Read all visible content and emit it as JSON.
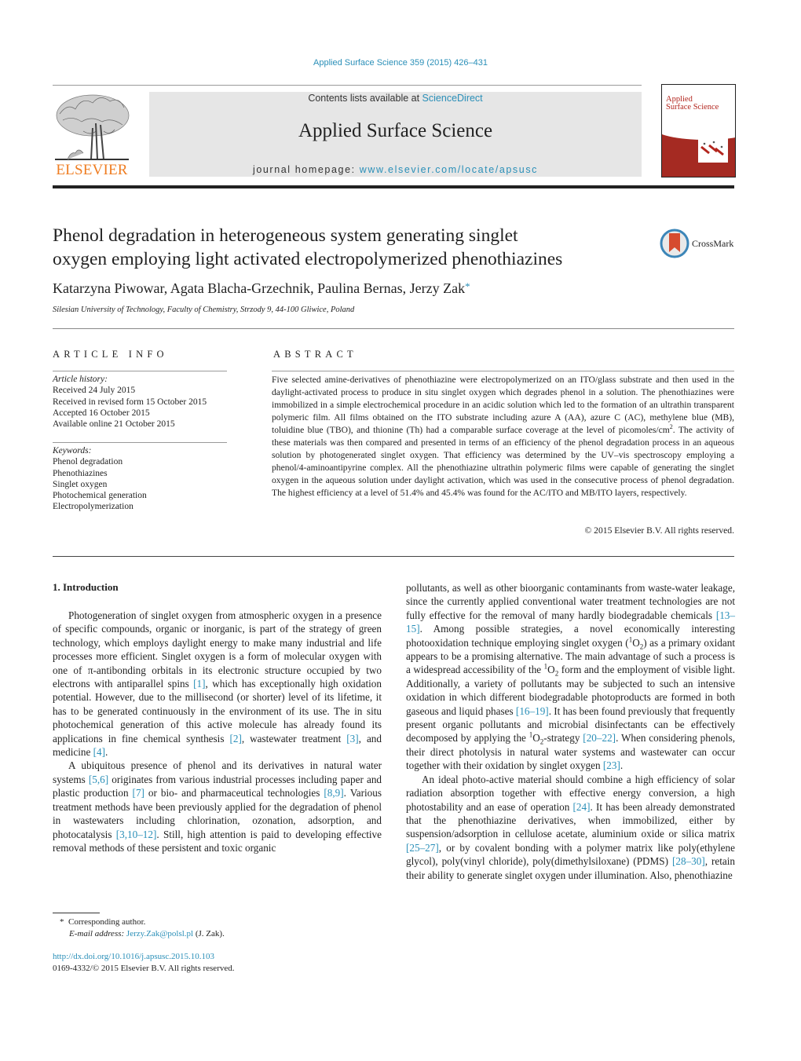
{
  "header": {
    "journal_ref": "Applied Surface Science 359 (2015) 426–431",
    "contents_prefix": "Contents lists available at ",
    "contents_link": "ScienceDirect",
    "journal_title": "Applied Surface Science",
    "homepage_prefix": "journal homepage: ",
    "homepage_link": "www.elsevier.com/locate/apsusc",
    "publisher": "ELSEVIER",
    "cover_title_1": "Applied",
    "cover_title_2": "Surface Science",
    "crossmark_label": "CrossMark"
  },
  "colors": {
    "link": "#2a8fb8",
    "elsevier_orange": "#ef7d22",
    "cover_red": "#a52a22",
    "masthead_gray": "#e6e6e6"
  },
  "article": {
    "title_line1": "Phenol degradation in heterogeneous system generating singlet",
    "title_line2": "oxygen employing light activated electropolymerized phenothiazines",
    "authors": "Katarzyna Piwowar, Agata Blacha-Grzechnik, Paulina Bernas, Jerzy Zak",
    "corresponding_mark": "*",
    "affiliation": "Silesian University of Technology, Faculty of Chemistry, Strzody 9, 44-100 Gliwice, Poland"
  },
  "article_info": {
    "heading": "ARTICLE INFO",
    "history_label": "Article history:",
    "history": [
      "Received 24 July 2015",
      "Received in revised form 15 October 2015",
      "Accepted 16 October 2015",
      "Available online 21 October 2015"
    ],
    "keywords_label": "Keywords:",
    "keywords": [
      "Phenol degradation",
      "Phenothiazines",
      "Singlet oxygen",
      "Photochemical generation",
      "Electropolymerization"
    ]
  },
  "abstract": {
    "heading": "ABSTRACT",
    "text_part1": "Five selected amine-derivatives of phenothiazine were electropolymerized on an ITO/glass substrate and then used in the daylight-activated process to produce in situ singlet oxygen which degrades phenol in a solution. The phenothiazines were immobilized in a simple electrochemical procedure in an acidic solution which led to the formation of an ultrathin transparent polymeric film. All films obtained on the ITO substrate including azure A (AA), azure C (AC), methylene blue (MB), toluidine blue (TBO), and thionine (Th) had a comparable surface coverage at the level of picomoles/cm",
    "text_sup": "2",
    "text_part2": ". The activity of these materials was then compared and presented in terms of an efficiency of the phenol degradation process in an aqueous solution by photogenerated singlet oxygen. That efficiency was determined by the UV–vis spectroscopy employing a phenol/4-aminoantipyrine complex. All the phenothiazine ultrathin polymeric films were capable of generating the singlet oxygen in the aqueous solution under daylight activation, which was used in the consecutive process of phenol degradation. The highest efficiency at a level of 51.4% and 45.4% was found for the AC/ITO and MB/ITO layers, respectively.",
    "copyright": "© 2015 Elsevier B.V. All rights reserved."
  },
  "introduction": {
    "heading": "1.  Introduction",
    "p1": [
      {
        "t": "Photogeneration of singlet oxygen from atmospheric oxygen in a presence of specific compounds, organic or inorganic, is part of the strategy of green technology, which employs daylight energy to make many industrial and life processes more efficient. Singlet oxygen is a form of molecular oxygen with one of π-antibonding orbitals in its electronic structure occupied by two electrons with antiparallel spins "
      },
      {
        "ref": "[1]"
      },
      {
        "t": ", which has exceptionally high oxidation potential. However, due to the millisecond (or shorter) level of its lifetime, it has to be generated continuously in the environment of its use. The in situ photochemical generation of this active molecule has already found its applications in fine chemical synthesis "
      },
      {
        "ref": "[2]"
      },
      {
        "t": ", wastewater treatment "
      },
      {
        "ref": "[3]"
      },
      {
        "t": ", and medicine "
      },
      {
        "ref": "[4]"
      },
      {
        "t": "."
      }
    ],
    "p2": [
      {
        "t": "A ubiquitous presence of phenol and its derivatives in natural water systems "
      },
      {
        "ref": "[5,6]"
      },
      {
        "t": " originates from various industrial processes including paper and plastic production "
      },
      {
        "ref": "[7]"
      },
      {
        "t": " or bio- and pharmaceutical technologies "
      },
      {
        "ref": "[8,9]"
      },
      {
        "t": ". Various treatment methods have been previously applied for the degradation of phenol in wastewaters including chlorination, ozonation, adsorption, and photocatalysis "
      },
      {
        "ref": "[3,10–12]"
      },
      {
        "t": ". Still, high attention is paid to developing effective removal methods of these persistent and toxic organic pollutants, as well as other bioorganic contaminants from waste-water leakage, since the currently applied conventional water treatment technologies are not fully effective for the removal of many hardly biodegradable chemicals "
      },
      {
        "ref": "[13–15]"
      },
      {
        "t": ". Among possible strategies, a novel economically interesting photooxidation technique employing singlet oxygen ("
      },
      {
        "sup": "1"
      },
      {
        "t": "O"
      },
      {
        "sub": "2"
      },
      {
        "t": ") as a primary oxidant appears to be a promising alternative. The main advantage of such a process is a widespread accessibility of the "
      },
      {
        "sup": "1"
      },
      {
        "t": "O"
      },
      {
        "sub": "2"
      },
      {
        "t": " form and the employment of visible light. Additionally, a variety of pollutants may be subjected to such an intensive oxidation in which different biodegradable photoproducts are formed in both gaseous and liquid phases "
      },
      {
        "ref": "[16–19]"
      },
      {
        "t": ". It has been found previously that frequently present organic pollutants and microbial disinfectants can be effectively decomposed by applying the "
      },
      {
        "sup": "1"
      },
      {
        "t": "O"
      },
      {
        "sub": "2"
      },
      {
        "t": "-strategy "
      },
      {
        "ref": "[20–22]"
      },
      {
        "t": ". When considering phenols, their direct photolysis in natural water systems and wastewater can occur together with their oxidation by singlet oxygen "
      },
      {
        "ref": "[23]"
      },
      {
        "t": "."
      }
    ],
    "p3": [
      {
        "t": "An ideal photo-active material should combine a high efficiency of solar radiation absorption together with effective energy conversion, a high photostability and an ease of operation "
      },
      {
        "ref": "[24]"
      },
      {
        "t": ". It has been already demonstrated that the phenothiazine derivatives, when immobilized, either by suspension/adsorption in cellulose acetate, aluminium oxide or silica matrix "
      },
      {
        "ref": "[25–27]"
      },
      {
        "t": ", or by covalent bonding with a polymer matrix like poly(ethylene glycol), poly(vinyl chloride), poly(dimethylsiloxane) (PDMS) "
      },
      {
        "ref": "[28–30]"
      },
      {
        "t": ", retain their ability to generate singlet oxygen under illumination. Also, phenothiazine"
      }
    ]
  },
  "footnote": {
    "mark": "*",
    "corresponding": "Corresponding author.",
    "email_label": "E-mail address:",
    "email": "Jerzy.Zak@polsl.pl",
    "email_suffix": " (J. Zak).",
    "doi": "http://dx.doi.org/10.1016/j.apsusc.2015.10.103",
    "issn_line": "0169-4332/© 2015 Elsevier B.V. All rights reserved."
  }
}
